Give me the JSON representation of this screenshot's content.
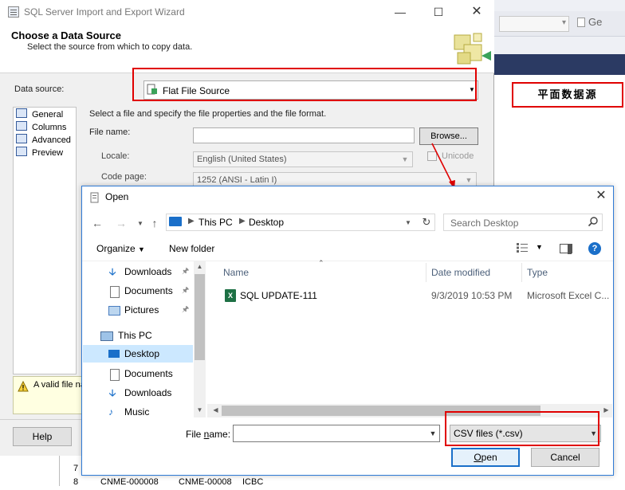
{
  "wizard": {
    "window_title": "SQL Server Import and Export Wizard",
    "heading": "Choose a Data Source",
    "subheading": "Select the source from which to copy data.",
    "data_source_label": "Data source:",
    "data_source_value": "Flat File Source",
    "nav_items": [
      "General",
      "Columns",
      "Advanced",
      "Preview"
    ],
    "description": "Select a file and specify the file properties and the file format.",
    "file_name_label": "File name:",
    "browse_label": "Browse...",
    "locale_label": "Locale:",
    "locale_value": "English (United States)",
    "unicode_label": "Unicode",
    "code_page_label": "Code page:",
    "code_page_value": "1252  (ANSI - Latin I)",
    "warning_text": "A valid file na",
    "help_label": "Help"
  },
  "annotation": {
    "cn_label": "平面数据源",
    "accent_color": "#e00000"
  },
  "background": {
    "toolbar_text": "Ge",
    "rows": [
      {
        "num": "7",
        "c1": "",
        "c2": "",
        "c3": ""
      },
      {
        "num": "8",
        "c1": "CNME-000008",
        "c2": "CNME-00008",
        "c3": "ICBC"
      }
    ]
  },
  "dialog": {
    "title": "Open",
    "address": [
      "This PC",
      "Desktop"
    ],
    "search_placeholder": "Search Desktop",
    "organize_label": "Organize",
    "new_folder_label": "New folder",
    "tree": [
      {
        "label": "Downloads",
        "icon": "download-icon",
        "pinned": true
      },
      {
        "label": "Documents",
        "icon": "document-icon",
        "pinned": true
      },
      {
        "label": "Pictures",
        "icon": "picture-icon",
        "pinned": true
      },
      {
        "label": "This PC",
        "icon": "computer-icon",
        "pinned": false
      },
      {
        "label": "Desktop",
        "icon": "desktop-icon",
        "pinned": false,
        "selected": true
      },
      {
        "label": "Documents",
        "icon": "document-icon",
        "pinned": false
      },
      {
        "label": "Downloads",
        "icon": "download-icon",
        "pinned": false
      },
      {
        "label": "Music",
        "icon": "music-icon",
        "pinned": false
      }
    ],
    "columns": [
      "Name",
      "Date modified",
      "Type"
    ],
    "files": [
      {
        "name": "SQL UPDATE-111",
        "date": "9/3/2019 10:53 PM",
        "type": "Microsoft Excel C...",
        "icon": "excel-icon"
      }
    ],
    "file_name_label_prefix": "File ",
    "file_name_label_accel": "n",
    "file_name_label_suffix": "ame:",
    "file_name_value": "",
    "file_type_value": "CSV files (*.csv)",
    "open_accel": "O",
    "open_rest": "pen",
    "cancel_label": "Cancel"
  }
}
